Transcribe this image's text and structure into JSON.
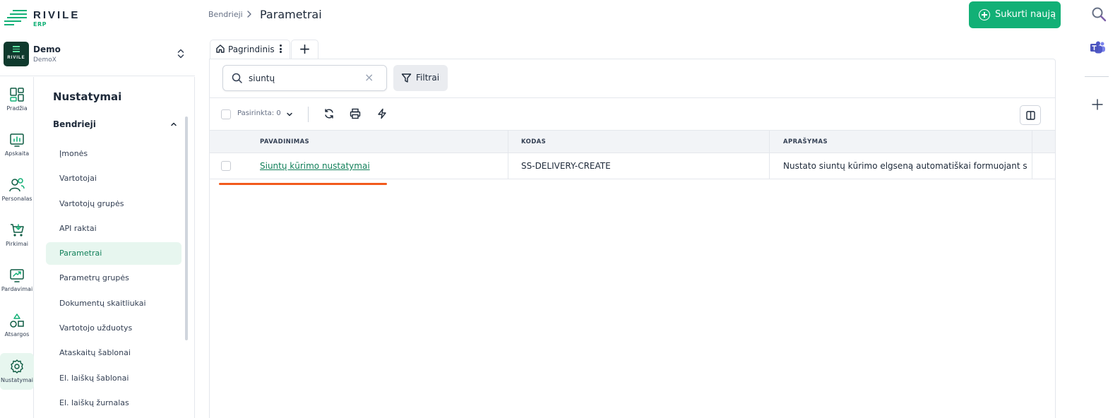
{
  "brand": {
    "name": "RIVILE",
    "sub": "ERP"
  },
  "company": {
    "name": "Demo",
    "code": "DemoX",
    "logo_text": "RIVILE"
  },
  "rail": [
    {
      "label": "Pradžia",
      "icon": "dashboard-icon"
    },
    {
      "label": "Apskaita",
      "icon": "chart-icon"
    },
    {
      "label": "Personalas",
      "icon": "people-icon"
    },
    {
      "label": "Pirkimai",
      "icon": "cart-icon"
    },
    {
      "label": "Pardavimai",
      "icon": "sales-icon"
    },
    {
      "label": "Atsargos",
      "icon": "shapes-icon"
    },
    {
      "label": "Nustatymai",
      "icon": "gear-icon",
      "active": true
    }
  ],
  "sidenav": {
    "title": "Nustatymai",
    "group": "Bendrieji",
    "items": [
      "Įmonės",
      "Vartotojai",
      "Vartotojų grupės",
      "API raktai",
      "Parametrai",
      "Parametrų grupės",
      "Dokumentų skaitliukai",
      "Vartotojo užduotys",
      "Ataskaitų šablonai",
      "El. laiškų šablonai",
      "El. laiškų žurnalas"
    ],
    "active_index": 4
  },
  "header": {
    "breadcrumb_parent": "Bendrieji",
    "title": "Parametrai",
    "create_label": "Sukurti naują"
  },
  "tabs": {
    "main_label": "Pagrindinis",
    "add_label": "+"
  },
  "search": {
    "value": "siuntų",
    "clear": "×"
  },
  "filter_label": "Filtrai",
  "toolbar": {
    "selected_label": "Pasirinkta: 0"
  },
  "table": {
    "columns": [
      "PAVADINIMAS",
      "KODAS",
      "APRAŠYMAS"
    ],
    "rows": [
      {
        "name": "Siuntų kūrimo nustatymai",
        "code": "SS-DELIVERY-CREATE",
        "description": "Nustato siuntų kūrimo elgseną automatiškai formuojant si"
      }
    ]
  },
  "colors": {
    "accent": "#12b076",
    "accent_dark": "#12805a",
    "active_bg": "#e7f6ef",
    "highlight": "#f25a1c"
  }
}
